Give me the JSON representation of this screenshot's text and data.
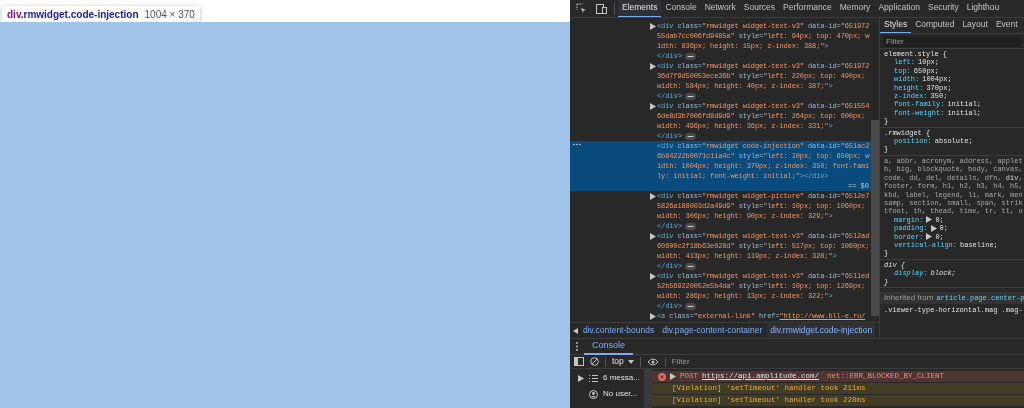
{
  "page": {
    "tooltip": {
      "selector_tag": "div",
      "selector_rest": ".rmwidget.code-injection",
      "size": "1004 × 370"
    }
  },
  "devtools": {
    "tabs": [
      {
        "label": "Elements",
        "selected": true
      },
      {
        "label": "Console",
        "selected": false
      },
      {
        "label": "Network",
        "selected": false
      },
      {
        "label": "Sources",
        "selected": false
      },
      {
        "label": "Performance",
        "selected": false
      },
      {
        "label": "Memory",
        "selected": false
      },
      {
        "label": "Application",
        "selected": false
      },
      {
        "label": "Security",
        "selected": false
      },
      {
        "label": "Lighthou",
        "selected": false
      }
    ],
    "elements": {
      "nodes": [
        {
          "expandable": true,
          "selected": false,
          "open_tag": "<div",
          "attributes": [
            {
              "name": "class=",
              "value": "\"rmwidget widget-text-v3\""
            },
            {
              "name": "data-id=",
              "value": "\"65197255dab7cc006fd9485a\""
            },
            {
              "name": "style=",
              "value": "\"left: 94px; top: 470px; width: 836px; height: 15px; z-index: 388;\""
            }
          ],
          "open_end": ">",
          "closing": "</div>"
        },
        {
          "expandable": true,
          "selected": false,
          "open_tag": "<div",
          "attributes": [
            {
              "name": "class=",
              "value": "\"rmwidget widget-text-v3\""
            },
            {
              "name": "data-id=",
              "value": "\"65197236d7f9d50053ece36b\""
            },
            {
              "name": "style=",
              "value": "\"left: 220px; top: 490px; width: 584px; height: 40px; z-index: 387;\""
            }
          ],
          "open_end": ">",
          "closing": "</div>"
        },
        {
          "expandable": true,
          "selected": false,
          "open_tag": "<div",
          "attributes": [
            {
              "name": "class=",
              "value": "\"rmwidget widget-text-v3\""
            },
            {
              "name": "data-id=",
              "value": "\"6515546de8d3b7006fd8d9d9\""
            },
            {
              "name": "style=",
              "value": "\"left: 264px; top: 600px; width: 496px; height: 36px; z-index: 331;\""
            }
          ],
          "open_end": ">",
          "closing": "</div>"
        },
        {
          "expandable": false,
          "selected": true,
          "open_tag": "<div",
          "attributes": [
            {
              "name": "class=",
              "value": "\"rmwidget code-injection\""
            },
            {
              "name": "data-id=",
              "value": "\"651ac26b84222b0071c11a4c\""
            },
            {
              "name": "style=",
              "value": "\"left: 10px; top: 650px; width: 1004px; height: 370px; z-index: 350; font-family: initial; font-weight: initial;\""
            }
          ],
          "open_end": "></div>",
          "console_ref": "== $0"
        },
        {
          "expandable": true,
          "selected": false,
          "open_tag": "<div",
          "attributes": [
            {
              "name": "class=",
              "value": "\"rmwidget widget-picture\""
            },
            {
              "name": "data-id=",
              "value": "\"6512e75826a188003d2a49d9\""
            },
            {
              "name": "style=",
              "value": "\"left: 10px; top: 1060px; width: 306px; height: 90px; z-index: 329;\""
            }
          ],
          "open_end": ">",
          "closing": "</div>"
        },
        {
          "expandable": true,
          "selected": false,
          "open_tag": "<div",
          "attributes": [
            {
              "name": "class=",
              "value": "\"rmwidget widget-text-v3\""
            },
            {
              "name": "data-id=",
              "value": "\"6512ad60600c2f18b63e028d\""
            },
            {
              "name": "style=",
              "value": "\"left: 517px; top: 1060px; width: 413px; height: 119px; z-index: 328;\""
            }
          ],
          "open_end": ">",
          "closing": "</div>"
        },
        {
          "expandable": true,
          "selected": false,
          "open_tag": "<div",
          "attributes": [
            {
              "name": "class=",
              "value": "\"rmwidget widget-text-v3\""
            },
            {
              "name": "data-id=",
              "value": "\"6511ed52b569220052e5b4da\""
            },
            {
              "name": "style=",
              "value": "\"left: 10px; top: 1269px; width: 286px; height: 13px; z-index: 322;\""
            }
          ],
          "open_end": ">",
          "closing": "</div>"
        },
        {
          "expandable": true,
          "selected": false,
          "open_tag": "<a",
          "attributes": [
            {
              "name": "class=",
              "value": "\"external-link\""
            },
            {
              "name": "href=",
              "value": "\"http://www.bll-e.ru/",
              "link": true
            }
          ]
        }
      ],
      "breadcrumbs": [
        {
          "label": "div.content-bounds",
          "selected": false
        },
        {
          "label": "div.page-content-container",
          "selected": false
        },
        {
          "label": "div.rmwidget.code-injection",
          "selected": true
        }
      ]
    },
    "styles": {
      "tabs": [
        {
          "label": "Styles",
          "selected": true
        },
        {
          "label": "Computed",
          "selected": false
        },
        {
          "label": "Layout",
          "selected": false
        },
        {
          "label": "Event",
          "selected": false
        }
      ],
      "filter": {
        "placeholder": "Filter"
      },
      "rules": [
        {
          "kind": "rule",
          "selector": "element.style {",
          "props": [
            {
              "name": "left:",
              "value": "10px;"
            },
            {
              "name": "top:",
              "value": "650px;"
            },
            {
              "name": "width:",
              "value": "1004px;"
            },
            {
              "name": "height:",
              "value": "370px;"
            },
            {
              "name": "z-index:",
              "value": "350;"
            },
            {
              "name": "font-family:",
              "value": "initial;"
            },
            {
              "name": "font-weight:",
              "value": "initial;"
            }
          ],
          "close": "}"
        },
        {
          "kind": "rule",
          "selector": ".rmwidget {",
          "props": [
            {
              "name": "position:",
              "value": "absolute;"
            }
          ],
          "close": "}"
        },
        {
          "kind": "multi",
          "selector_lines": [
            "a, abbr, acronym, address, applet",
            "b, big, blockquote, body, canvas,",
            "code, dd, del, details, dfn, **div**,",
            "footer, form, h1, h2, h3, h4, h5,",
            "kbd, label, legend, li, mark, men",
            "samp, section, small, span, strik",
            "tfoot, th, thead, time, tr, tt, u"
          ],
          "props": [
            {
              "name": "margin:",
              "value": "0;",
              "expandable": true
            },
            {
              "name": "padding:",
              "value": "0;",
              "expandable": true
            },
            {
              "name": "border:",
              "value": "0;",
              "expandable": true
            },
            {
              "name": "vertical-align:",
              "value": "baseline;"
            }
          ],
          "close": "}"
        },
        {
          "kind": "ua_rule",
          "selector": "div {",
          "props": [
            {
              "name": "display:",
              "value": "block;"
            }
          ],
          "close": "}"
        },
        {
          "kind": "inherited",
          "label": "Inherited from",
          "target": "article.page.center-p"
        },
        {
          "kind": "selector",
          "selector": ".viewer-type-horizontal.mag .mag-"
        }
      ]
    },
    "console": {
      "tab": {
        "label": "Console",
        "selected": true
      },
      "context": "top",
      "filter": {
        "placeholder": "Filter"
      },
      "sidebar": [
        {
          "kind": "messages",
          "label": "6 messa..."
        },
        {
          "kind": "user",
          "label": "No user..."
        }
      ],
      "messages": [
        {
          "kind": "error",
          "method": "POST",
          "url": "https://api.amplitude.com/",
          "text": "net::ERR_BLOCKED_BY_CLIENT"
        },
        {
          "kind": "warning",
          "text": "[Violation] 'setTimeout' handler took 211ms"
        },
        {
          "kind": "warning",
          "text": "[Violation] 'setTimeout' handler took 228ms"
        }
      ]
    }
  }
}
